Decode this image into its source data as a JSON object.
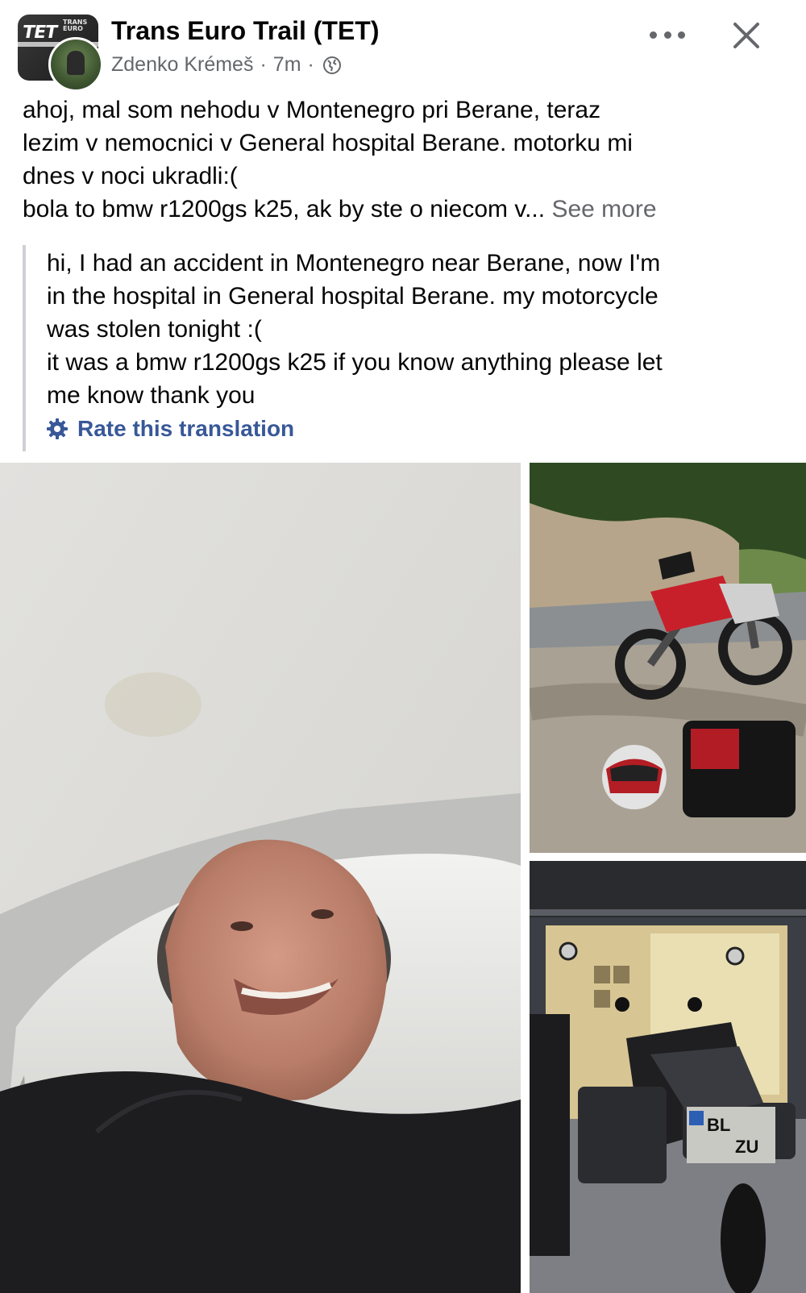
{
  "header": {
    "group_name": "Trans Euro Trail (TET)",
    "author": "Zdenko Krémeš",
    "separator": "·",
    "time": "7m",
    "audience_icon": "globe-icon",
    "more_icon": "more-horizontal-icon",
    "close_icon": "close-icon",
    "avatar_logo": "TET",
    "avatar_logo_small": "TRANS EURO"
  },
  "post": {
    "lines": [
      "ahoj, mal som nehodu v Montenegro pri Berane, teraz",
      "lezim v nemocnici v General hospital Berane. motorku mi",
      "dnes v noci ukradli:(",
      "bola to bmw r1200gs k25, ak by ste o niecom v..."
    ],
    "see_more": "See more"
  },
  "translation": {
    "lines": [
      "hi, I had an accident in Montenegro near Berane, now I'm",
      "in the hospital in General hospital Berane. my motorcycle",
      "was stolen tonight :(",
      "it was a bmw r1200gs k25 if you know anything please let",
      "me know thank you"
    ],
    "rate_label": "Rate this translation",
    "rate_icon": "gear-icon"
  },
  "photos": {
    "plate_text": "BL",
    "plate_text_2": "ZU"
  },
  "colors": {
    "text": "#050505",
    "muted": "#65676b",
    "link": "#385898",
    "quote_bar": "#ced0d4"
  }
}
